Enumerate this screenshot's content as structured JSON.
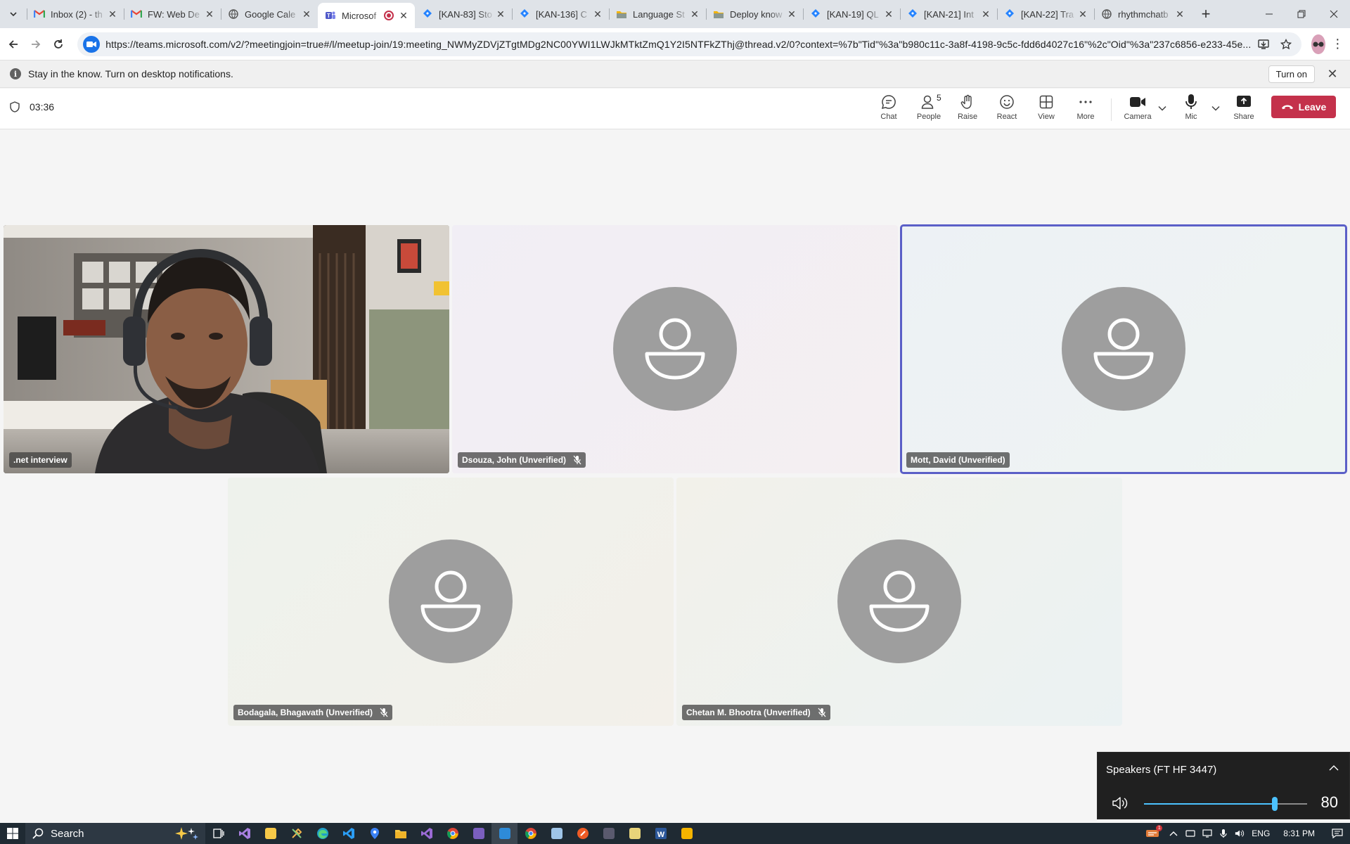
{
  "browser": {
    "tabs": [
      {
        "title": "Inbox (2) - th",
        "icon": "gmail-icon",
        "active": false
      },
      {
        "title": "FW: Web De",
        "icon": "gmail-icon",
        "active": false
      },
      {
        "title": "Google Cale",
        "icon": "globe-icon",
        "active": false
      },
      {
        "title": "Microsof",
        "icon": "teams-icon",
        "active": true,
        "recording": true
      },
      {
        "title": "[KAN-83] Sto",
        "icon": "jira-icon",
        "active": false
      },
      {
        "title": "[KAN-136] C",
        "icon": "jira-icon",
        "active": false
      },
      {
        "title": "Language St",
        "icon": "folder-icon",
        "active": false
      },
      {
        "title": "Deploy know",
        "icon": "folder-icon",
        "active": false
      },
      {
        "title": "[KAN-19] QL",
        "icon": "jira-icon",
        "active": false
      },
      {
        "title": "[KAN-21] Int",
        "icon": "jira-icon",
        "active": false
      },
      {
        "title": "[KAN-22] Tra",
        "icon": "jira-icon",
        "active": false
      },
      {
        "title": "rhythmchatb",
        "icon": "globe-icon",
        "active": false
      }
    ],
    "url": "https://teams.microsoft.com/v2/?meetingjoin=true#/l/meetup-join/19:meeting_NWMyZDVjZTgtMDg2NC00YWI1LWJkMTktZmQ1Y2I5NTFkZThj@thread.v2/0?context=%7b\"Tid\"%3a\"b980c11c-3a8f-4198-9c5c-fdd6d4027c16\"%2c\"Oid\"%3a\"237c6856-e233-45e..."
  },
  "banner": {
    "message": "Stay in the know. Turn on desktop notifications.",
    "button_label": "Turn on"
  },
  "meeting": {
    "timer": "03:36",
    "controls": {
      "chat": "Chat",
      "people": "People",
      "people_count": "5",
      "raise": "Raise",
      "react": "React",
      "view": "View",
      "more": "More",
      "camera": "Camera",
      "mic": "Mic",
      "share": "Share",
      "leave": "Leave"
    },
    "participants": [
      {
        "name": ".net interview",
        "video": true,
        "muted": false,
        "speaking": false
      },
      {
        "name": "Dsouza, John (Unverified)",
        "video": false,
        "muted": true,
        "speaking": false
      },
      {
        "name": "Mott, David (Unverified)",
        "video": false,
        "muted": false,
        "speaking": true
      },
      {
        "name": "Bodagala, Bhagavath (Unverified)",
        "video": false,
        "muted": true,
        "speaking": false
      },
      {
        "name": "Chetan M. Bhootra (Unverified)",
        "video": false,
        "muted": true,
        "speaking": false
      }
    ]
  },
  "volume": {
    "device": "Speakers (FT HF 3447)",
    "level": 80
  },
  "taskbar": {
    "search_label": "Search",
    "language": "ENG",
    "time": "8:31 PM",
    "notification_count": "1"
  },
  "colors": {
    "leave": "#c4314b",
    "speaking_outline": "#5b5fc7",
    "avatar": "#9e9e9e",
    "volume_accent": "#4cc2ff"
  }
}
